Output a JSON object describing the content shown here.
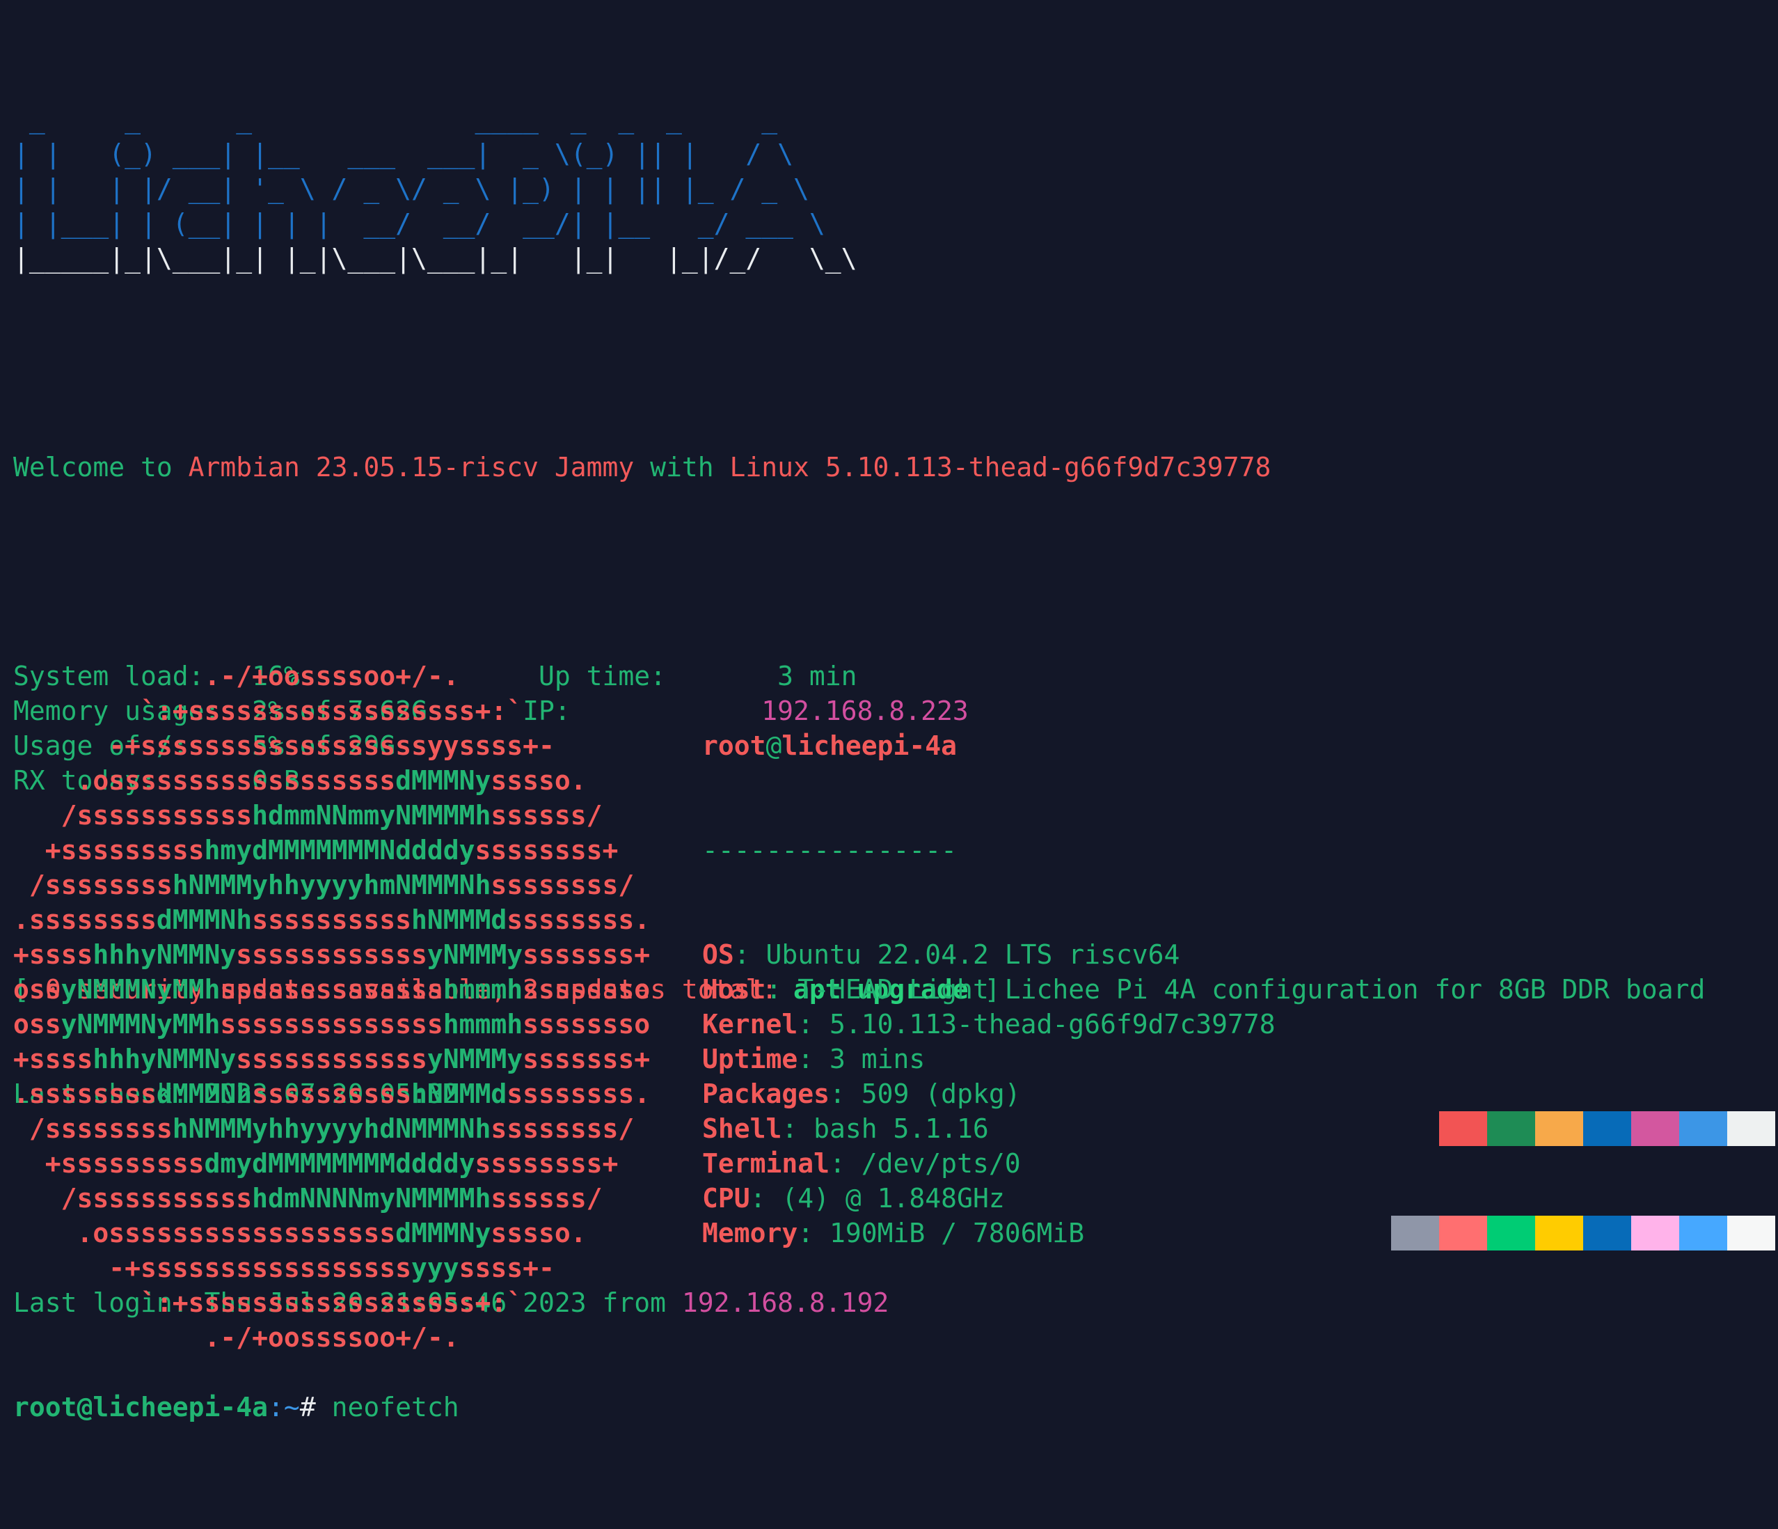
{
  "colors": {
    "background": "#131728",
    "banner_blue": "#1e73c8",
    "banner_white": "#e9ecef",
    "banner_gray": "#9aa0b0",
    "green": "#22b573",
    "red": "#f25a5a",
    "magenta": "#d34fa0",
    "bright_green": "#28d17c",
    "white": "#e9ecef"
  },
  "banner": {
    "art_lines": [
      [
        {
          "t": " _     _      _              ____  _  _  _     _",
          "c": "banner_blue"
        }
      ],
      [
        {
          "t": "| |   (_) ___| |__   ___  ___|  _ \\(_) || |   / \\",
          "c": "banner_blue"
        }
      ],
      [
        {
          "t": "| |   | |/ __| '_ \\ / _ \\/ _ \\ |_) | | || |_ / _ \\",
          "c": "banner_blue"
        }
      ],
      [
        {
          "t": "| |___| | (__| | | |  __/  __/  __/| |__   _/ ___ \\",
          "c": "banner_blue"
        }
      ],
      [
        {
          "t": "|_____|_|\\___|_| |_|\\___|\\___|_|   |_|   |_|/_/   \\_\\",
          "c": "banner_white"
        }
      ]
    ]
  },
  "welcome": {
    "prefix": "Welcome to ",
    "distro": "Armbian 23.05.15-riscv Jammy",
    "mid": " with ",
    "kernel": "Linux 5.10.113-thead-g66f9d7c39778"
  },
  "motd_stats": [
    {
      "label": "System load:   ",
      "value": "16%",
      "pad": "               ",
      "label2": "Up time:       ",
      "value2": "3 min",
      "value2_color": "green"
    },
    {
      "label": "Memory usage:  ",
      "value": "2% of 7.62G",
      "pad": "      ",
      "label2": "IP:            ",
      "value2": "192.168.8.223",
      "value2_color": "magenta"
    },
    {
      "label": "Usage of /:    ",
      "value": "5% of 29G",
      "pad": "",
      "label2": "",
      "value2": "",
      "value2_color": "green"
    },
    {
      "label": "RX today:      ",
      "value": "0 B",
      "pad": "",
      "label2": "",
      "value2": "",
      "value2_color": "green"
    }
  ],
  "updates": {
    "open_bracket": "[ ",
    "text": "0 security updates available, 2 updates total: ",
    "command": "apt upgrade",
    "close_bracket": " ]",
    "last_check_label": "Last check: ",
    "last_check_value": "2023-07-20 05:32"
  },
  "last_login": {
    "label": "Last login: ",
    "timestamp": "Thu Jul 20 21:05:46 2023",
    "from": " from ",
    "ip": "192.168.8.192"
  },
  "prompt": {
    "user_host": "root@licheepi-4a",
    "path": ":~",
    "symbol": "# ",
    "command": "neofetch"
  },
  "neofetch": {
    "logo_lines": [
      [
        {
          "t": "            .-/+oossssoo+/-.",
          "c": "red"
        }
      ],
      [
        {
          "t": "        `:+ssssssssssssssssss+:`",
          "c": "red"
        }
      ],
      [
        {
          "t": "      -+ssssssssssssssssssyyssss+-",
          "c": "red"
        }
      ],
      [
        {
          "t": "    .ossssssssssssssssss",
          "c": "red"
        },
        {
          "t": "dMMMNy",
          "c": "green"
        },
        {
          "t": "sssso.",
          "c": "red"
        }
      ],
      [
        {
          "t": "   /sssssssssss",
          "c": "red"
        },
        {
          "t": "hdmmNNmmyNMMMMh",
          "c": "green"
        },
        {
          "t": "ssssss/",
          "c": "red"
        }
      ],
      [
        {
          "t": "  +sssssssss",
          "c": "red"
        },
        {
          "t": "hmydMMMMMMMNddddy",
          "c": "green"
        },
        {
          "t": "ssssssss+",
          "c": "red"
        }
      ],
      [
        {
          "t": " /ssssssss",
          "c": "red"
        },
        {
          "t": "hNMMMyhhyyyyhmNMMMNh",
          "c": "green"
        },
        {
          "t": "ssssssss/",
          "c": "red"
        }
      ],
      [
        {
          "t": ".ssssssss",
          "c": "red"
        },
        {
          "t": "dMMMNh",
          "c": "green"
        },
        {
          "t": "ssssssssss",
          "c": "red"
        },
        {
          "t": "hNMMMd",
          "c": "green"
        },
        {
          "t": "ssssssss.",
          "c": "red"
        }
      ],
      [
        {
          "t": "+ssss",
          "c": "red"
        },
        {
          "t": "hhhyNMMNy",
          "c": "green"
        },
        {
          "t": "ssssssssssss",
          "c": "red"
        },
        {
          "t": "yNMMMy",
          "c": "green"
        },
        {
          "t": "sssssss+",
          "c": "red"
        }
      ],
      [
        {
          "t": "oss",
          "c": "red"
        },
        {
          "t": "yNMMMNyMMh",
          "c": "green"
        },
        {
          "t": "ssssssssssssss",
          "c": "red"
        },
        {
          "t": "hmmmh",
          "c": "green"
        },
        {
          "t": "ssssssso",
          "c": "red"
        }
      ],
      [
        {
          "t": "oss",
          "c": "red"
        },
        {
          "t": "yNMMMNyMMh",
          "c": "green"
        },
        {
          "t": "ssssssssssssss",
          "c": "red"
        },
        {
          "t": "hmmmh",
          "c": "green"
        },
        {
          "t": "ssssssso",
          "c": "red"
        }
      ],
      [
        {
          "t": "+ssss",
          "c": "red"
        },
        {
          "t": "hhhyNMMNy",
          "c": "green"
        },
        {
          "t": "ssssssssssss",
          "c": "red"
        },
        {
          "t": "yNMMMy",
          "c": "green"
        },
        {
          "t": "sssssss+",
          "c": "red"
        }
      ],
      [
        {
          "t": ".ssssssss",
          "c": "red"
        },
        {
          "t": "dMMMNh",
          "c": "green"
        },
        {
          "t": "ssssssssss",
          "c": "red"
        },
        {
          "t": "hNMMMd",
          "c": "green"
        },
        {
          "t": "ssssssss.",
          "c": "red"
        }
      ],
      [
        {
          "t": " /ssssssss",
          "c": "red"
        },
        {
          "t": "hNMMMyhhyyyyhdNMMMNh",
          "c": "green"
        },
        {
          "t": "ssssssss/",
          "c": "red"
        }
      ],
      [
        {
          "t": "  +sssssssss",
          "c": "red"
        },
        {
          "t": "dmydMMMMMMMMddddy",
          "c": "green"
        },
        {
          "t": "ssssssss+",
          "c": "red"
        }
      ],
      [
        {
          "t": "   /sssssssssss",
          "c": "red"
        },
        {
          "t": "hdmNNNNmyNMMMMh",
          "c": "green"
        },
        {
          "t": "ssssss/",
          "c": "red"
        }
      ],
      [
        {
          "t": "    .ossssssssssssssssss",
          "c": "red"
        },
        {
          "t": "dMMMNy",
          "c": "green"
        },
        {
          "t": "sssso.",
          "c": "red"
        }
      ],
      [
        {
          "t": "      -+sssssssssssssssss",
          "c": "red"
        },
        {
          "t": "yyy",
          "c": "green"
        },
        {
          "t": "ssss+-",
          "c": "red"
        }
      ],
      [
        {
          "t": "        `:+ssssssssssssssssss+:`",
          "c": "red"
        }
      ],
      [
        {
          "t": "            .-/+oossssoo+/-.",
          "c": "red"
        }
      ]
    ],
    "title_user": "root",
    "title_at": "@",
    "title_host": "licheepi-4a",
    "separator": "----------------",
    "fields": [
      {
        "key": "OS",
        "value": "Ubuntu 22.04.2 LTS riscv64"
      },
      {
        "key": "Host",
        "value": "T-HEAD Light Lichee Pi 4A configuration for 8GB DDR board"
      },
      {
        "key": "Kernel",
        "value": "5.10.113-thead-g66f9d7c39778"
      },
      {
        "key": "Uptime",
        "value": "3 mins"
      },
      {
        "key": "Packages",
        "value": "509 (dpkg)"
      },
      {
        "key": "Shell",
        "value": "bash 5.1.16"
      },
      {
        "key": "Terminal",
        "value": "/dev/pts/0"
      },
      {
        "key": "CPU",
        "value": "(4) @ 1.848GHz"
      },
      {
        "key": "Memory",
        "value": "190MiB / 7806MiB"
      }
    ],
    "palette_top": [
      "#131728",
      "#f25454",
      "#1e8c55",
      "#f7a94a",
      "#076bb8",
      "#d3579f",
      "#3c96e6",
      "#eef1f1"
    ],
    "palette_bottom": [
      "#8f96a8",
      "#ff6f70",
      "#00cc74",
      "#ffcc00",
      "#076bb8",
      "#ffb3ea",
      "#46a8ff",
      "#f6f7f7"
    ]
  }
}
